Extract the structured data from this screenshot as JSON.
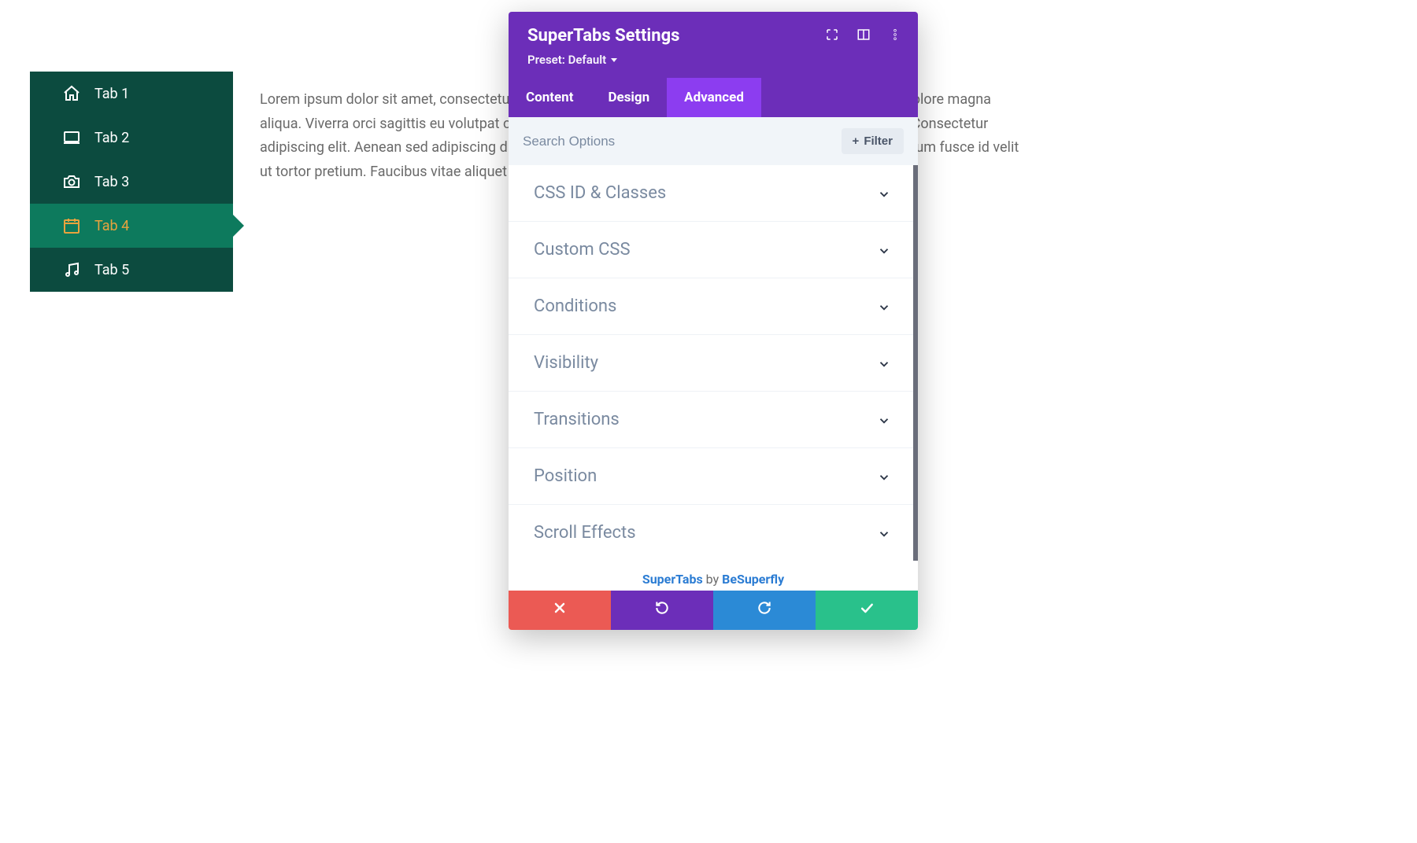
{
  "sidebar": {
    "items": [
      {
        "label": "Tab 1",
        "icon": "home"
      },
      {
        "label": "Tab 2",
        "icon": "laptop"
      },
      {
        "label": "Tab 3",
        "icon": "camera"
      },
      {
        "label": "Tab 4",
        "icon": "calendar",
        "active": true
      },
      {
        "label": "Tab 5",
        "icon": "music"
      }
    ]
  },
  "body": {
    "text": "Lorem ipsum dolor sit amet, consectetur adipiscing elit, sed do eiusmod tempor incididunt ut labore et dolore magna aliqua. Viverra orci sagittis eu volutpat odio facilisis mauris sit amet. Imperdiet proin fermentum leo vel. Consectetur adipiscing elit. Aenean sed adipiscing diam donec adipiscing tristique risus nec feugiat. Feugiat nisl pretium fusce id velit ut tortor pretium. Faucibus vitae aliquet nec ullamcorper sit amet risus nullam."
  },
  "panel": {
    "title": "SuperTabs Settings",
    "preset_label": "Preset: Default",
    "tabs": [
      {
        "label": "Content"
      },
      {
        "label": "Design"
      },
      {
        "label": "Advanced",
        "active": true
      }
    ],
    "search_placeholder": "Search Options",
    "filter_label": "Filter",
    "options": [
      {
        "label": "CSS ID & Classes"
      },
      {
        "label": "Custom CSS"
      },
      {
        "label": "Conditions"
      },
      {
        "label": "Visibility"
      },
      {
        "label": "Transitions"
      },
      {
        "label": "Position"
      },
      {
        "label": "Scroll Effects"
      }
    ],
    "credit": {
      "product": "SuperTabs",
      "by": " by ",
      "author": "BeSuperfly"
    }
  }
}
